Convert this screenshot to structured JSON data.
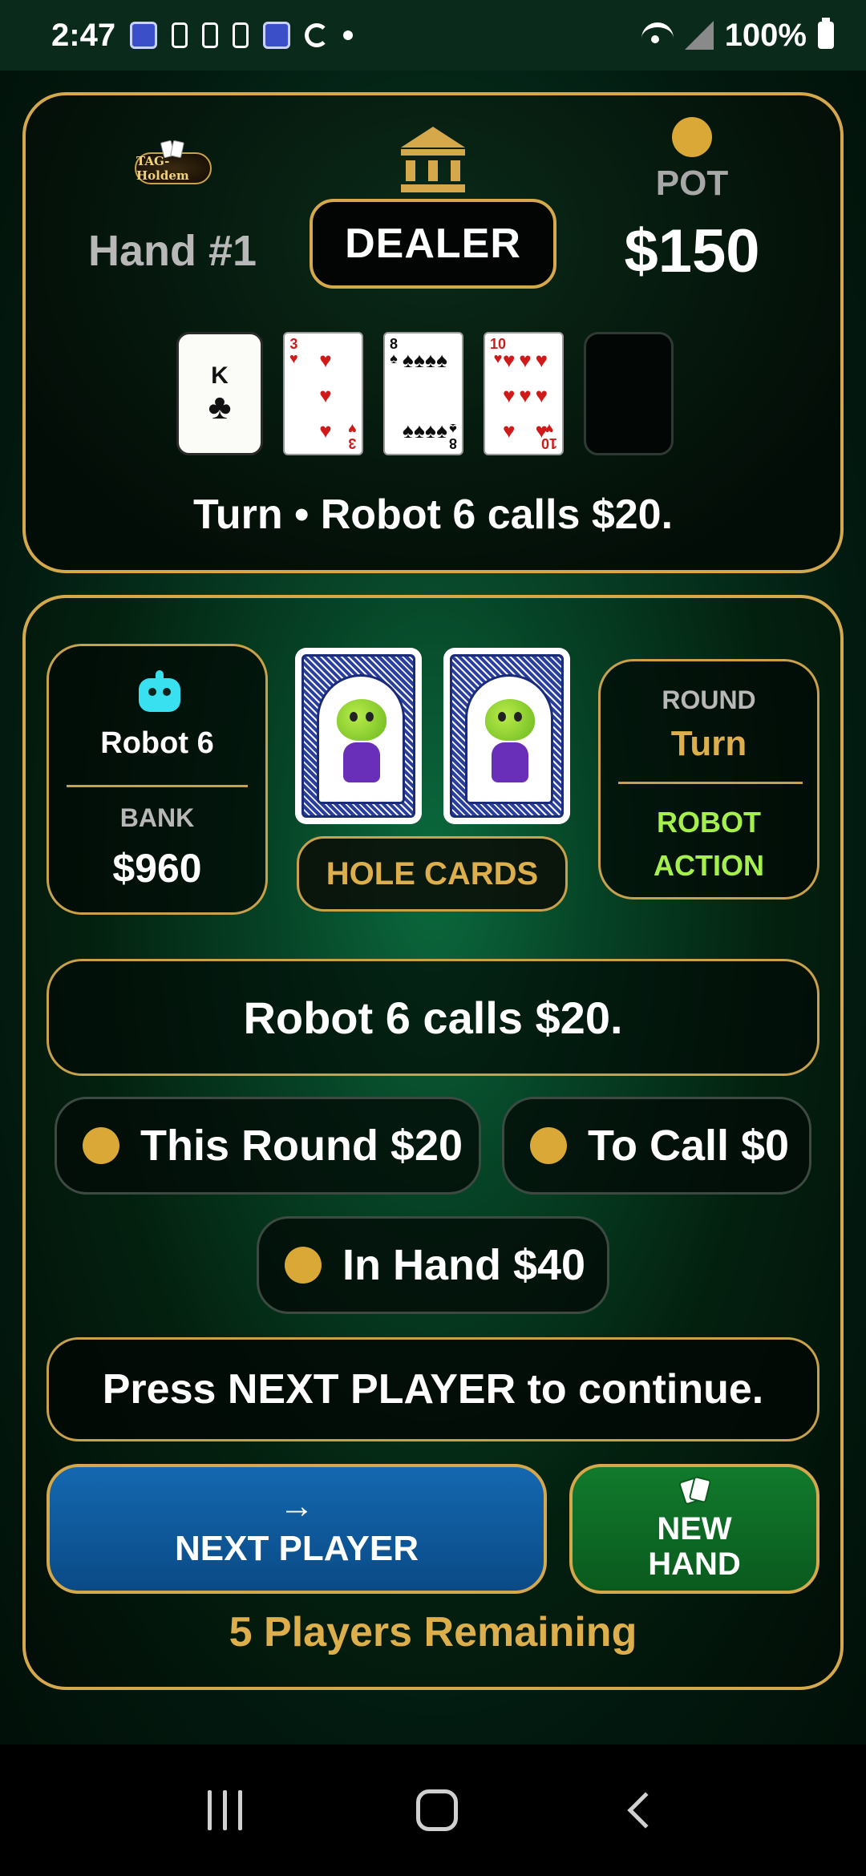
{
  "status_bar": {
    "time": "2:47",
    "battery": "100%"
  },
  "header": {
    "logo_text": "TAG-Holdem",
    "hand_label": "Hand #1",
    "dealer_label": "DEALER",
    "pot_label": "POT",
    "pot_value": "$150"
  },
  "board": {
    "cards": [
      {
        "rank": "K",
        "suit": "♣",
        "color": "#0e0e0e"
      },
      {
        "rank": "3",
        "suit": "♥",
        "color": "#d01a1a"
      },
      {
        "rank": "8",
        "suit": "♠",
        "color": "#0e0e0e"
      },
      {
        "rank": "10",
        "suit": "♥",
        "color": "#d01a1a"
      }
    ],
    "empty_slots": 1,
    "street_text": "Turn  •  Robot 6 calls $20."
  },
  "player": {
    "icon": "robot-icon",
    "name": "Robot 6",
    "bank_label": "BANK",
    "bank_value": "$960",
    "hole_cards_label": "HOLE CARDS"
  },
  "round": {
    "label": "ROUND",
    "value": "Turn",
    "action_line1": "ROBOT",
    "action_line2": "ACTION"
  },
  "message": "Robot 6 calls $20.",
  "chips": {
    "this_round": "This Round $20",
    "to_call": "To Call $0",
    "in_hand": "In Hand $40"
  },
  "instruction": "Press NEXT PLAYER to continue.",
  "buttons": {
    "next_arrow": "→",
    "next_label": "NEXT PLAYER",
    "new_label": "NEW\nHAND"
  },
  "remaining": "5 Players Remaining",
  "colors": {
    "gold": "#d4a84b",
    "felt": "#0b6a3e",
    "green_action": "#a6f04e",
    "next_button": "#1468b0",
    "new_button": "#117a2c"
  }
}
